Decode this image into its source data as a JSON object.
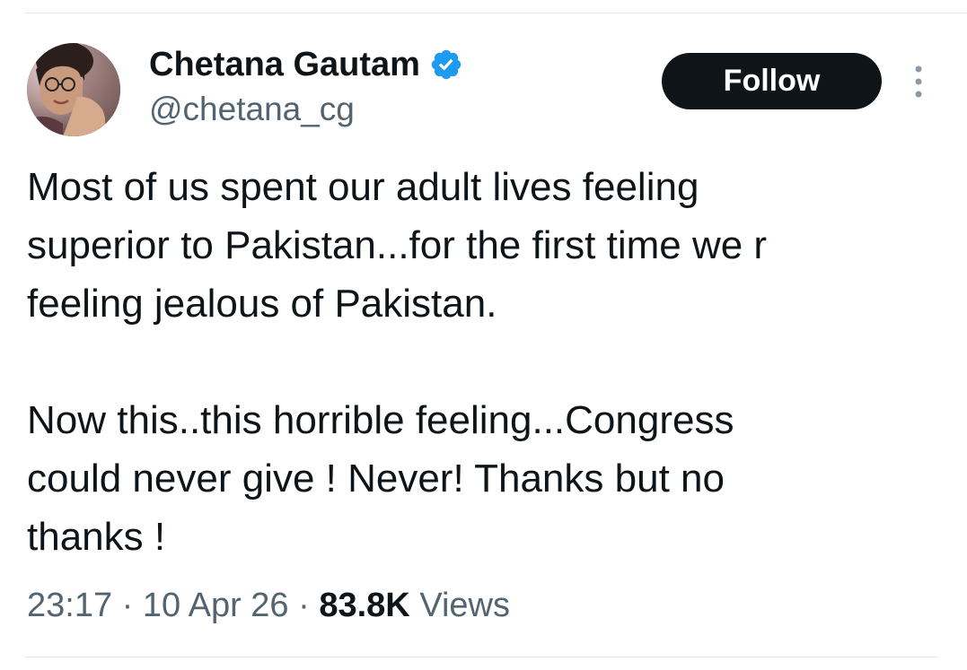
{
  "tweet": {
    "author": {
      "display_name": "Chetana Gautam",
      "handle": "@chetana_cg",
      "verified": true,
      "verified_color": "#1d9bf0"
    },
    "follow_label": "Follow",
    "more_icon": "more-vertical-icon",
    "text": "Most of us spent our adult lives feeling\nsuperior to Pakistan...for the first time we r\nfeeling jealous of Pakistan.\n\nNow this..this horrible feeling...Congress\ncould never give ! Never! Thanks but no\nthanks !",
    "time": "23:17",
    "separator": "·",
    "date": "10 Apr 26",
    "views_count": "83.8K",
    "views_label": "Views"
  },
  "colors": {
    "primary_text": "#0f1419",
    "secondary_text": "#536471",
    "button_bg": "#0f1419",
    "divider": "#e4e7ea"
  }
}
